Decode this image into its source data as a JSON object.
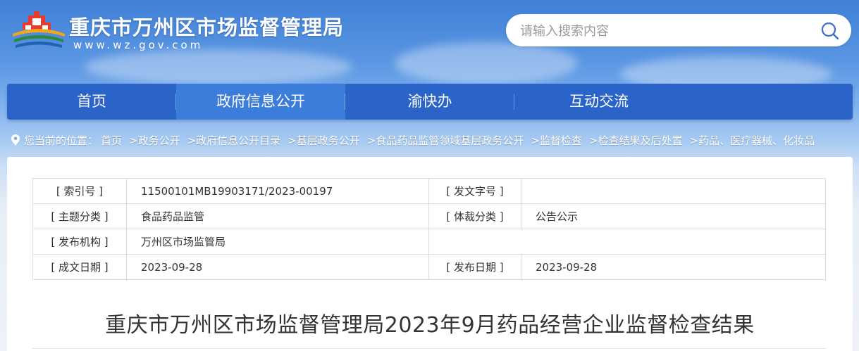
{
  "header": {
    "site_title": "重庆市万州区市场监督管理局",
    "site_url": "www.wz.gov.com",
    "logo_icon": "city-gate-logo-icon",
    "search": {
      "placeholder": "请输入搜索内容",
      "value": "",
      "button_icon": "search-icon"
    }
  },
  "nav": {
    "items": [
      {
        "label": "首页"
      },
      {
        "label": "政府信息公开",
        "active": true
      },
      {
        "label": "渝快办"
      },
      {
        "label": "互动交流"
      }
    ]
  },
  "breadcrumb": {
    "icon": "location-pin-icon",
    "label": "您当前的位置：",
    "items": [
      "首页",
      ">政务公开",
      ">政府信息公开目录",
      ">基层政务公开",
      ">食品药品监管领域基层政务公开",
      ">监督检查",
      ">检查结果及后处置",
      ">药品、医疗器械、化妆品"
    ]
  },
  "meta": {
    "index_no_label": "[ 索引号 ]",
    "index_no": "11500101MB19903171/2023-00197",
    "doc_no_label": "[ 发文字号 ]",
    "doc_no": "",
    "topic_label": "[ 主题分类 ]",
    "topic": "食品药品监管",
    "genre_label": "[ 体裁分类 ]",
    "genre": "公告公示",
    "publisher_label": "[ 发布机构 ]",
    "publisher": "万州区市场监管局",
    "created_label": "[ 成文日期 ]",
    "created": "2023-09-28",
    "published_label": "[ 发布日期 ]",
    "published": "2023-09-28"
  },
  "document": {
    "title": "重庆市万州区市场监督管理局2023年9月药品经营企业监督检查结果"
  },
  "colors": {
    "nav_bg": "#2a64c8",
    "nav_active": "#3b7ddb",
    "title_text": "#333333"
  }
}
